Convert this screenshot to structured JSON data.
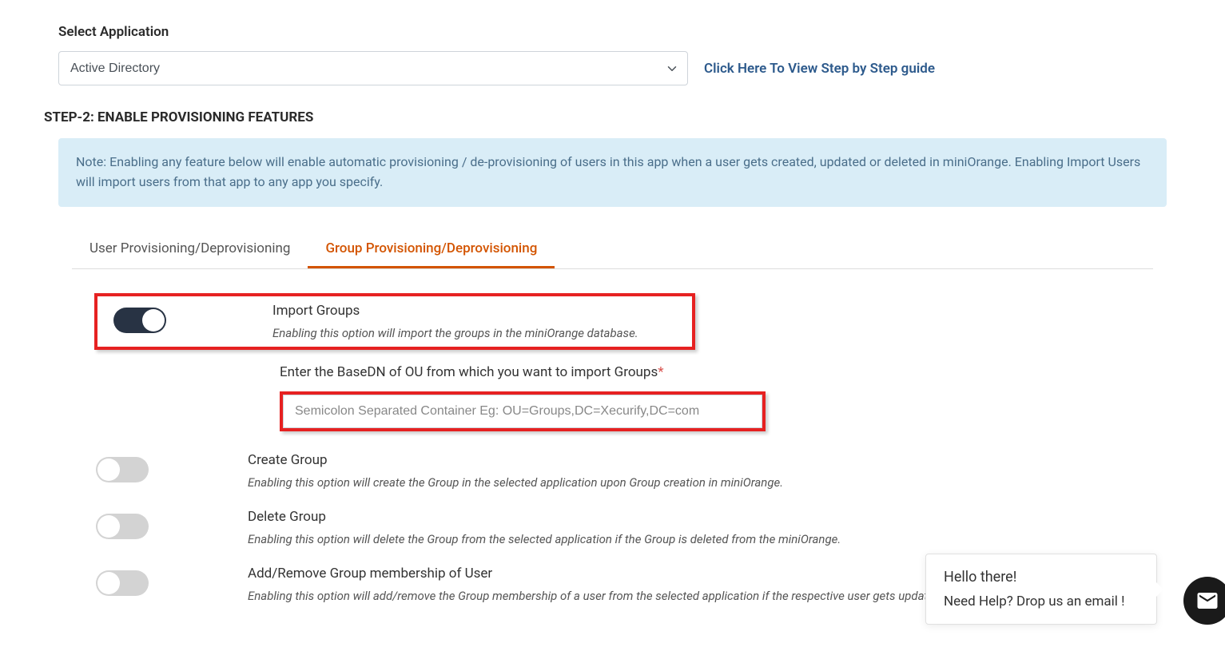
{
  "selectApp": {
    "label": "Select Application",
    "value": "Active Directory",
    "guideLink": "Click Here To View Step by Step guide"
  },
  "step": {
    "title": "STEP-2: ENABLE PROVISIONING FEATURES",
    "note": "Note: Enabling any feature below will enable automatic provisioning / de-provisioning of users in this app when a user gets created, updated or deleted in miniOrange. Enabling Import Users will import users from that app to any app you specify."
  },
  "tabs": {
    "userProv": "User Provisioning/Deprovisioning",
    "groupProv": "Group Provisioning/Deprovisioning"
  },
  "features": {
    "importGroups": {
      "title": "Import Groups",
      "desc": "Enabling this option will import the groups in the miniOrange database."
    },
    "basedn": {
      "label": "Enter the BaseDN of OU from which you want to import Groups",
      "placeholder": "Semicolon Separated Container Eg: OU=Groups,DC=Xecurify,DC=com"
    },
    "createGroup": {
      "title": "Create Group",
      "desc": "Enabling this option will create the Group in the selected application upon Group creation in miniOrange."
    },
    "deleteGroup": {
      "title": "Delete Group",
      "desc": "Enabling this option will delete the Group from the selected application if the Group is deleted from the miniOrange."
    },
    "addRemove": {
      "title": "Add/Remove Group membership of User",
      "desc": "Enabling this option will add/remove the Group membership of a user from the selected application if the respective user gets updated from the miniOrange."
    }
  },
  "chat": {
    "title": "Hello there!",
    "text": "Need Help? Drop us an email !"
  }
}
